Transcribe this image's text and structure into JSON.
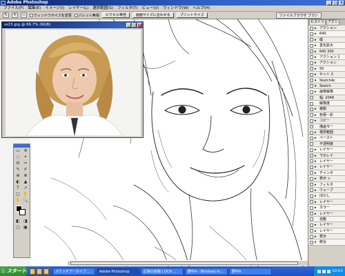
{
  "app": {
    "title": "Adobe Photoshop"
  },
  "window_buttons": [
    "_",
    "□",
    "×"
  ],
  "menu": [
    "ファイル(F)",
    "編集(E)",
    "イメージ(I)",
    "レイヤー(L)",
    "選択範囲(S)",
    "フィルタ(T)",
    "ビュー(V)",
    "ウィンドウ(W)",
    "ヘルプ(H)"
  ],
  "options": {
    "icon_main": "↖",
    "icon_zoom_in": "+",
    "icon_zoom_out": "−",
    "resize_window": "ウィンドウサイズを変更",
    "ignore_palettes": "パレット無視",
    "actual_pixels": "ピクセル等倍",
    "fit_on_screen": "画面サイズに合わせる",
    "print_size": "プリントサイズ",
    "palette_well_tab": "ファイルブラウザ ブラシ"
  },
  "document": {
    "title": "ss15.jpg @ 66.7% (RGB)",
    "buttons": [
      "_",
      "□",
      "×"
    ]
  },
  "tools": [
    "▭",
    "✣",
    "◌",
    "⌖",
    "⊡",
    "✂",
    "✎",
    "✐",
    "⊕",
    "⊗",
    "◐",
    "▲",
    "T",
    "↗",
    "□",
    "✋",
    "✋",
    "🔍",
    "",
    "",
    "◧",
    "◨",
    "▢",
    "▣"
  ],
  "palette": {
    "tabs": [
      "ヒストリ",
      "アクシ"
    ],
    "rows": [
      {
        "label": "アクション",
        "exp": "▸"
      },
      {
        "label": "640",
        "exp": "▸"
      },
      {
        "label": "縦",
        "exp": "▸"
      },
      {
        "label": "直化拡大",
        "exp": "▸"
      },
      {
        "label": "640 300",
        "exp": "▸"
      },
      {
        "label": "アクション 1",
        "exp": "▸"
      },
      {
        "label": "アクション",
        "exp": "▸"
      },
      {
        "label": "50",
        "exp": "▸"
      },
      {
        "label": "セット 2",
        "exp": "▸"
      },
      {
        "label": "SketchAc",
        "exp": "▾"
      },
      {
        "label": "Sketch",
        "exp": "▾"
      },
      {
        "label": "画像解像",
        "exp": "▸"
      },
      {
        "label": "幅: 2048",
        "exp": ""
      },
      {
        "label": "解像度",
        "exp": ""
      },
      {
        "label": "複製",
        "exp": "▸"
      },
      {
        "label": "色相・彩",
        "exp": "▸"
      },
      {
        "label": "コピー",
        "exp": "▸"
      },
      {
        "label": "描画モー",
        "exp": ""
      },
      {
        "label": "選択範囲",
        "exp": "▸"
      },
      {
        "label": "ペースト",
        "exp": "▸"
      },
      {
        "label": "不透明度",
        "exp": ""
      },
      {
        "label": "レイヤー",
        "exp": "▸"
      },
      {
        "label": "下のレイ",
        "exp": "▸"
      },
      {
        "label": "レイヤー",
        "exp": "▸"
      },
      {
        "label": "レイヤー",
        "exp": "▸"
      },
      {
        "label": "チャンネ",
        "exp": "▸"
      },
      {
        "label": "表示 レ",
        "exp": "▸"
      },
      {
        "label": "フィルタ",
        "exp": "▸"
      },
      {
        "label": "ウェーブ",
        "exp": "▸"
      },
      {
        "label": "ぼかし",
        "exp": "▸"
      },
      {
        "label": "レイヤー",
        "exp": "▸"
      },
      {
        "label": "カラー",
        "exp": "▸"
      },
      {
        "label": "レイヤー",
        "exp": "▸"
      },
      {
        "label": "自動",
        "exp": ""
      },
      {
        "label": "レイヤー",
        "exp": "▸"
      },
      {
        "label": "レイヤー",
        "exp": "▸"
      },
      {
        "label": "表示",
        "exp": "▸"
      },
      {
        "label": "統合",
        "exp": "▸"
      }
    ]
  },
  "taskbar": {
    "start": "スタート",
    "tasks": [
      {
        "label": "スケッチアーカイブ ...",
        "active": false
      },
      {
        "label": "Adobe Photoshop",
        "active": true
      },
      {
        "label": "記事の投稿 | OCN ...",
        "active": false
      },
      {
        "label": "野中A - Windows In...",
        "active": false
      },
      {
        "label": "野中A",
        "active": false
      }
    ],
    "clock": "10:01"
  }
}
